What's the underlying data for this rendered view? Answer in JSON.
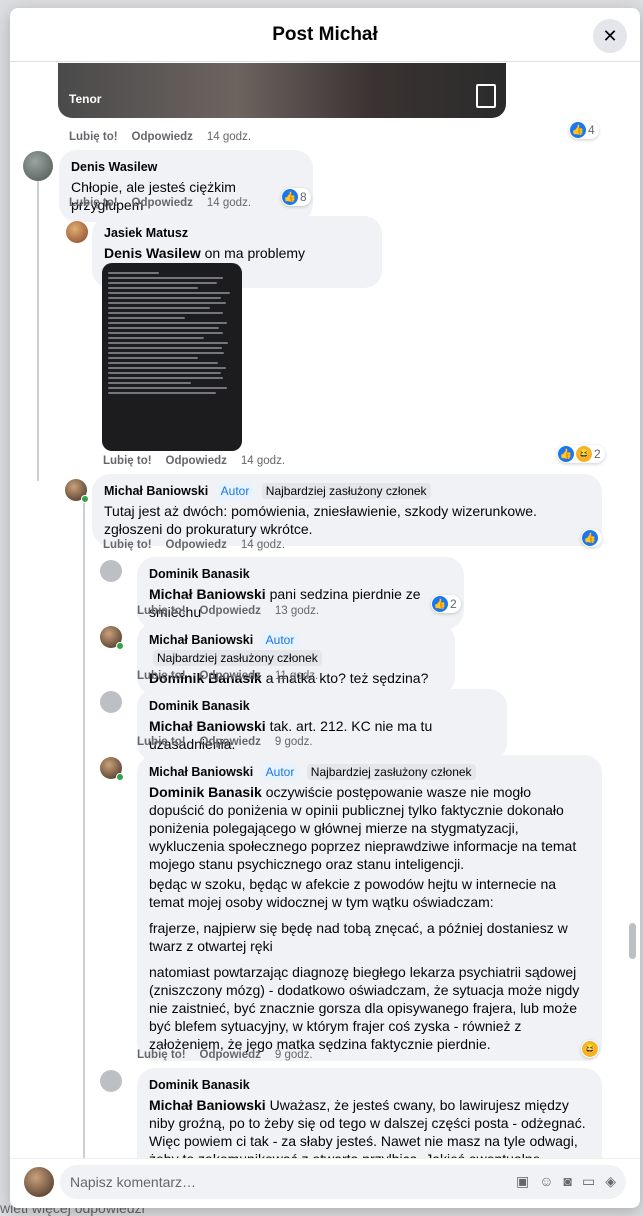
{
  "modal": {
    "title": "Post Michał",
    "close_icon": "close-icon"
  },
  "gif": {
    "label": "Tenor"
  },
  "gif_comment_actions": {
    "like": "Lubię to!",
    "reply": "Odpowiedz",
    "time": "14 godz."
  },
  "gif_reaction_count": "4",
  "comments": [
    {
      "author": "Denis Wasilew",
      "text": "Chłopie, ale jesteś ciężkim przygłupem",
      "like": "Lubię to!",
      "reply": "Odpowiedz",
      "time": "14 godz.",
      "reactions": "8"
    },
    {
      "author": "Jasiek Matusz",
      "mention": "Denis Wasilew",
      "text": " on ma problemy psychiczne.",
      "like": "Lubię to!",
      "reply": "Odpowiedz",
      "time": "14 godz.",
      "reactions": "2"
    },
    {
      "author": "Michał Baniowski",
      "badge_author": "Autor",
      "badge_member": "Najbardziej zasłużony członek",
      "text": "Tutaj jest aż dwóch: pomówienia, zniesławienie, szkody wizerunkowe. zgłoszeni do prokuratury wkrótce.",
      "like": "Lubię to!",
      "reply": "Odpowiedz",
      "time": "14 godz."
    },
    {
      "author": "Dominik Banasik",
      "mention": "Michał Baniowski",
      "text": " pani sedzina pierdnie ze smiechu",
      "like": "Lubię to!",
      "reply": "Odpowiedz",
      "time": "13 godz.",
      "reactions": "2"
    },
    {
      "author": "Michał Baniowski",
      "badge_author": "Autor",
      "badge_member": "Najbardziej zasłużony członek",
      "mention": "Dominik Banasik",
      "text": " a matka kto? też sędzina?",
      "like": "Lubię to!",
      "reply": "Odpowiedz",
      "time": "11 godz."
    },
    {
      "author": "Dominik Banasik",
      "mention": "Michał Baniowski",
      "text": " tak. art. 212. KC nie ma tu uzasadnienia.",
      "like": "Lubię to!",
      "reply": "Odpowiedz",
      "time": "9 godz."
    },
    {
      "author": "Michał Baniowski",
      "badge_author": "Autor",
      "badge_member": "Najbardziej zasłużony członek",
      "mention": "Dominik Banasik",
      "text": " oczywiście postępowanie wasze nie mogło dopuścić do poniżenia w opinii publicznej tylko faktycznie dokonało poniżenia polegającego w głównej mierze na stygmatyzacji, wykluczenia społecznego poprzez nieprawdziwe informacje na temat mojego stanu psychicznego oraz stanu inteligencji.",
      "text2": "będąc w szoku, będąc w afekcie z powodów hejtu w internecie na temat mojej osoby widocznej w tym wątku oświadczam:",
      "text3": "frajerze, najpierw się będę nad tobą znęcać, a później dostaniesz w twarz z otwartej ręki",
      "text4": "natomiast powtarzając diagnozę biegłego lekarza psychiatrii sądowej (zniszczony mózg) - dodatkowo oświadczam, że sytuacja może nigdy nie zaistnieć, być znacznie gorsza dla opisywanego frajera, lub może być blefem sytuacyjny, w którym frajer coś zyska - również z założeniem, że jego matka sędzina faktycznie pierdnie.",
      "like": "Lubię to!",
      "reply": "Odpowiedz",
      "time": "9 godz."
    },
    {
      "author": "Dominik Banasik",
      "mention": "Michał Baniowski",
      "text": " Uważasz, że jesteś cwany, bo lawirujesz między niby groźną, po to żeby się od tego w dalszej części posta - odżegnać. Więc powiem ci tak - za słaby jesteś. Nawet nie masz na tyle odwagi, żeby to zakomunikować z otwartą przyłbicą. Jakieś ewentualne uszczerbki fizyczne"
    }
  ],
  "composer": {
    "placeholder": "Napisz komentarz…"
  },
  "backdrop": {
    "bottom_text": "wietl więcej odpowiedzi"
  },
  "colors": {
    "accent": "#1877f2",
    "bubble": "#f0f2f5"
  }
}
